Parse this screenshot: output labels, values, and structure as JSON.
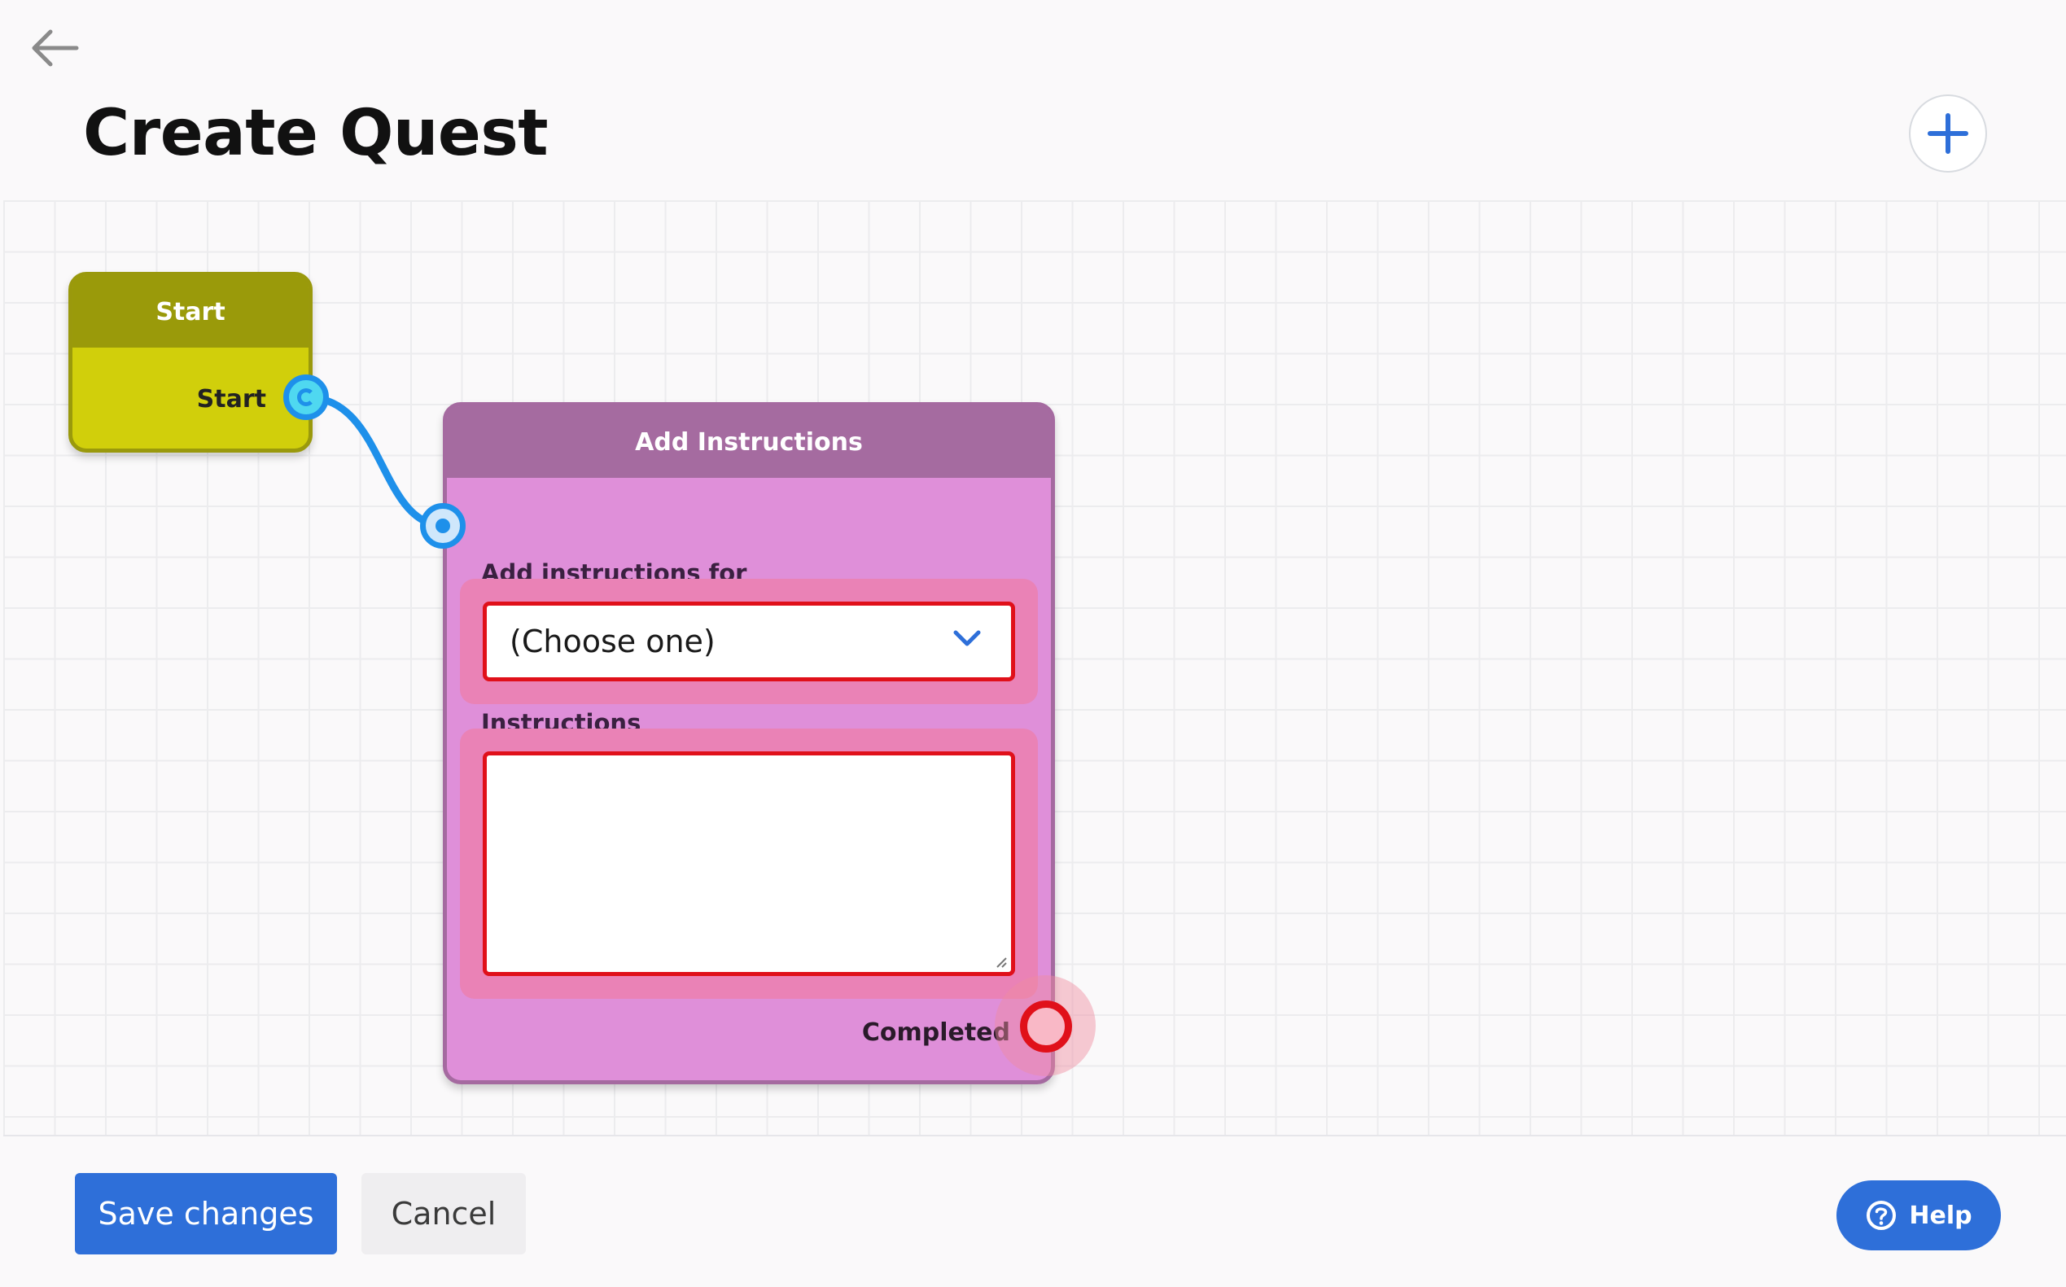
{
  "header": {
    "title": "Create Quest",
    "back_icon": "arrow-left-icon",
    "add_icon": "plus-icon"
  },
  "nodes": {
    "start": {
      "title": "Start",
      "output_label": "Start",
      "color": "#d1cf0b"
    },
    "add_instructions": {
      "title": "Add Instructions",
      "color": "#df8fd9",
      "select_label": "Add instructions for",
      "select_value": "(Choose one)",
      "textarea_label": "Instructions",
      "textarea_value": "",
      "output_label": "Completed"
    }
  },
  "footer": {
    "save_label": "Save changes",
    "cancel_label": "Cancel",
    "help_label": "Help",
    "help_icon": "question-circle-icon"
  },
  "colors": {
    "accent": "#2e6fd9",
    "connection": "#1e90ea",
    "error": "#e0101a"
  }
}
